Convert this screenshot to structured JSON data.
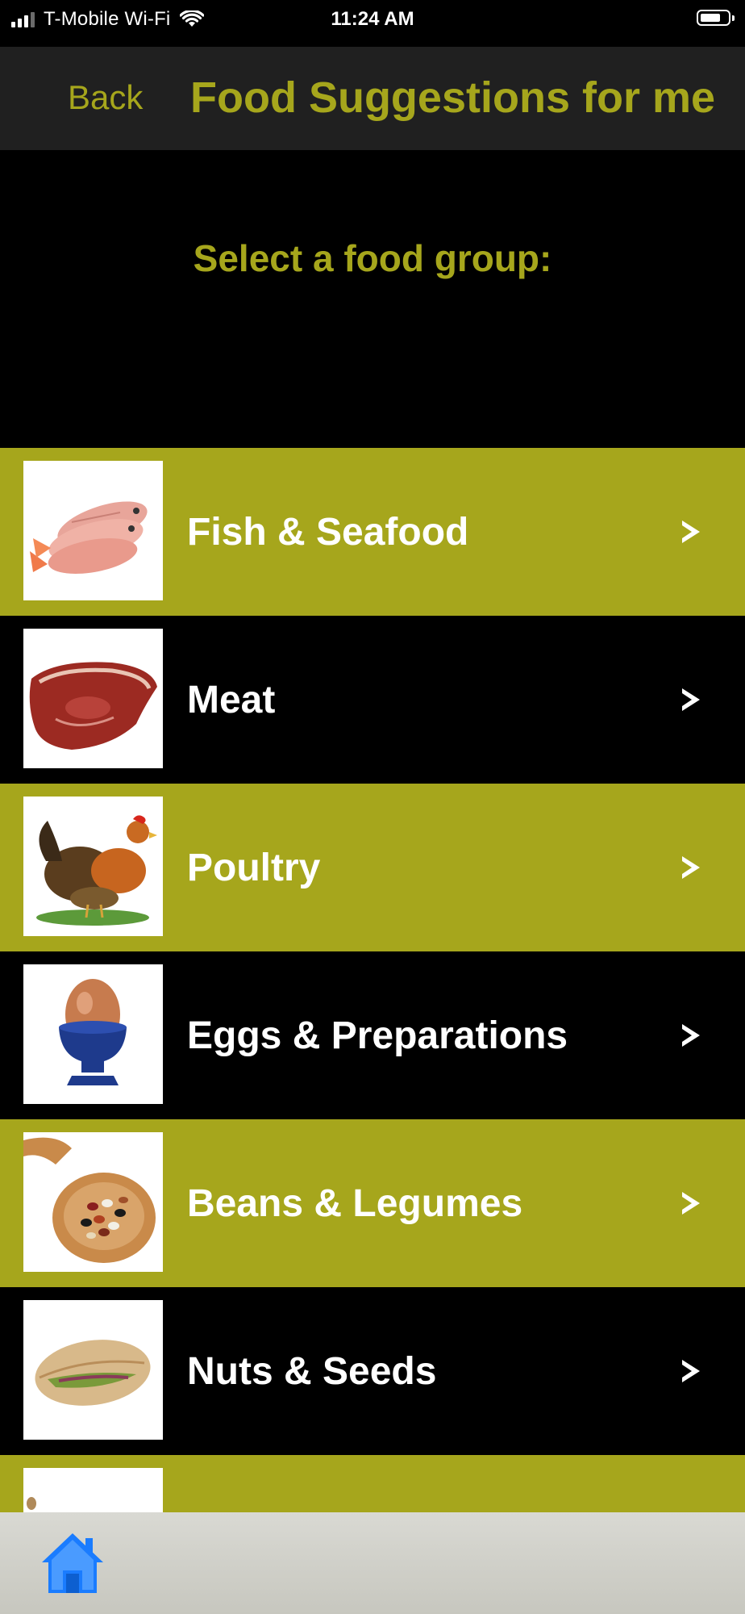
{
  "status_bar": {
    "carrier": "T-Mobile Wi-Fi",
    "time": "11:24 AM"
  },
  "nav": {
    "back_label": "Back",
    "title": "Food Suggestions for me"
  },
  "prompt": "Select a food group:",
  "colors": {
    "accent": "#a6a61c",
    "nav_background": "#202020",
    "toolbar": "#d2d2cb",
    "home_icon": "#1a7cff"
  },
  "food_groups": [
    {
      "label": "Fish & Seafood",
      "icon": "fish-icon"
    },
    {
      "label": "Meat",
      "icon": "steak-icon"
    },
    {
      "label": "Poultry",
      "icon": "chicken-icon"
    },
    {
      "label": "Eggs & Preparations",
      "icon": "egg-icon"
    },
    {
      "label": "Beans & Legumes",
      "icon": "beans-icon"
    },
    {
      "label": "Nuts & Seeds",
      "icon": "nut-icon"
    },
    {
      "label": "",
      "icon": "partial-item-icon"
    }
  ],
  "toolbar": {
    "home_icon": "home-icon"
  }
}
